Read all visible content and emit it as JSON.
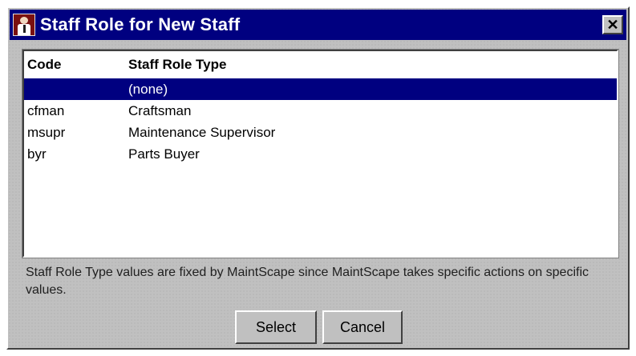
{
  "window": {
    "title": "Staff Role for New Staff",
    "close_glyph": "✕"
  },
  "list": {
    "columns": {
      "code": "Code",
      "type": "Staff Role Type"
    },
    "rows": [
      {
        "code": "",
        "type": "(none)",
        "selected": true
      },
      {
        "code": "cfman",
        "type": "Craftsman",
        "selected": false
      },
      {
        "code": "msupr",
        "type": "Maintenance Supervisor",
        "selected": false
      },
      {
        "code": "byr",
        "type": "Parts Buyer",
        "selected": false
      }
    ]
  },
  "note": "Staff Role Type values are fixed by MaintScape since MaintScape takes specific actions on specific values.",
  "buttons": {
    "select": "Select",
    "cancel": "Cancel"
  },
  "colors": {
    "titlebar": "#000080",
    "selection": "#000080",
    "face": "#c0c0c0"
  }
}
